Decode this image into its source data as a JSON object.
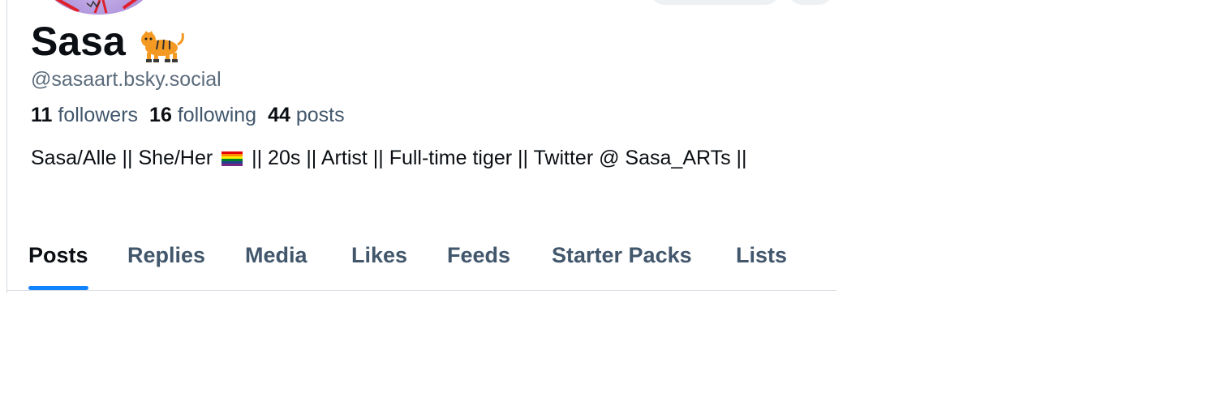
{
  "profile": {
    "display_name": "Sasa",
    "name_emoji": "tiger-emoji",
    "handle": "@sasaart.bsky.social",
    "stats": {
      "followers_count": "11",
      "followers_label": "followers",
      "following_count": "16",
      "following_label": "following",
      "posts_count": "44",
      "posts_label": "posts"
    },
    "bio": {
      "part1": "Sasa/Alle || She/Her",
      "flag_icon": "rainbow-flag-emoji",
      "part2": "|| 20s || Artist || Full-time tiger ||  Twitter @ Sasa_ARTs ||"
    }
  },
  "tabs": [
    {
      "label": "Posts",
      "active": true
    },
    {
      "label": "Replies",
      "active": false
    },
    {
      "label": "Media",
      "active": false
    },
    {
      "label": "Likes",
      "active": false
    },
    {
      "label": "Feeds",
      "active": false
    },
    {
      "label": "Starter Packs",
      "active": false
    },
    {
      "label": "Lists",
      "active": false
    }
  ],
  "colors": {
    "accent": "#1083fe",
    "text_primary": "#0b0f14",
    "text_secondary": "#42576c",
    "border": "#d4dbe2"
  }
}
